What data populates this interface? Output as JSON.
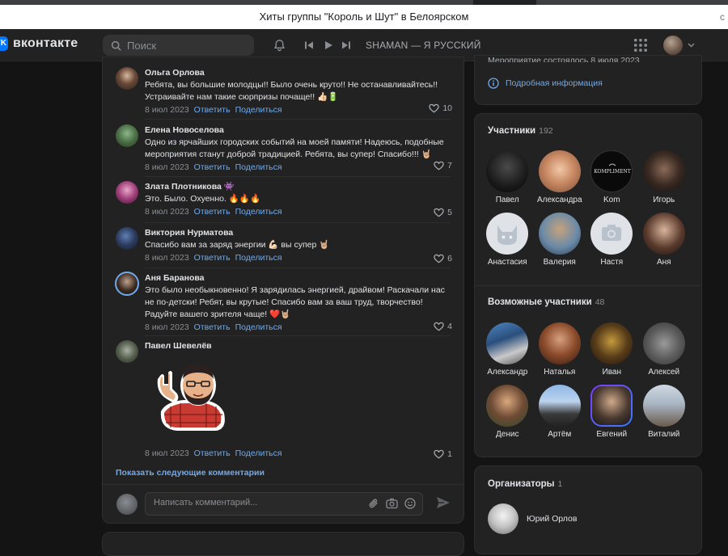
{
  "browser": {
    "tab_title": "Хиты группы \"Король и Шут\" в Белоярском",
    "right_glyph": "c"
  },
  "header": {
    "logo": "вконтакте",
    "search_placeholder": "Поиск",
    "player_track": "SHAMAN — Я РУССКИЙ"
  },
  "comments": [
    {
      "author": "Ольга Орлова",
      "text": "Ребята, вы большие молодцы!! Было очень круто!! Не останавливайтесь!! Устраивайте нам такие сюрпризы почаще!! 👍🏻🔋",
      "date": "8 июл 2023",
      "reply": "Ответить",
      "share": "Поделиться",
      "likes": "10"
    },
    {
      "author": "Елена Новоселова",
      "text": "Одно из ярчайших городских событий на моей памяти! Надеюсь, подобные мероприятия станут доброй традицией. Ребята, вы супер! Спасибо!!! 🤘🏼",
      "date": "8 июл 2023",
      "reply": "Ответить",
      "share": "Поделиться",
      "likes": "7"
    },
    {
      "author": "Злата Плотникова 👾",
      "text": "Это. Было. Охуенно. 🔥🔥🔥",
      "date": "8 июл 2023",
      "reply": "Ответить",
      "share": "Поделиться",
      "likes": "5"
    },
    {
      "author": "Виктория Нурматова",
      "text": "Спасибо вам за заряд энергии 💪🏻 вы супер 🤘🏼",
      "date": "8 июл 2023",
      "reply": "Ответить",
      "share": "Поделиться",
      "likes": "6"
    },
    {
      "author": "Аня Баранова",
      "text": "Это было необыкновенно! Я зарядилась энергией, драйвом! Раскачали нас не по-детски! Ребят, вы крутые! Спасибо вам за ваш труд, творчество! Радуйте вашего зрителя чаще! ❤️🤘🏼",
      "date": "8 июл 2023",
      "reply": "Ответить",
      "share": "Поделиться",
      "likes": "4"
    },
    {
      "author": "Павел Шевелёв",
      "text": "",
      "date": "8 июл 2023",
      "reply": "Ответить",
      "share": "Поделиться",
      "likes": "1"
    }
  ],
  "show_more": "Показать следующие комментарии",
  "compose_placeholder": "Написать комментарий...",
  "info": {
    "cut_text": "Мероприятие состоялось 8 июля 2023",
    "details_link": "Подробная информация"
  },
  "members": {
    "title": "Участники",
    "count": "192",
    "people": [
      "Павел",
      "Александра",
      "Kom",
      "Игорь",
      "Анастасия",
      "Валерия",
      "Настя",
      "Аня"
    ]
  },
  "possible": {
    "title": "Возможные участники",
    "count": "48",
    "people": [
      "Александр",
      "Наталья",
      "Иван",
      "Алексей",
      "Денис",
      "Артём",
      "Евгений",
      "Виталий"
    ]
  },
  "organizers": {
    "title": "Организаторы",
    "count": "1",
    "name": "Юрий Орлов"
  },
  "colors": {
    "accent": "#71aaeb",
    "brand": "#0077ff",
    "bg": "#141414",
    "card": "#222222"
  }
}
